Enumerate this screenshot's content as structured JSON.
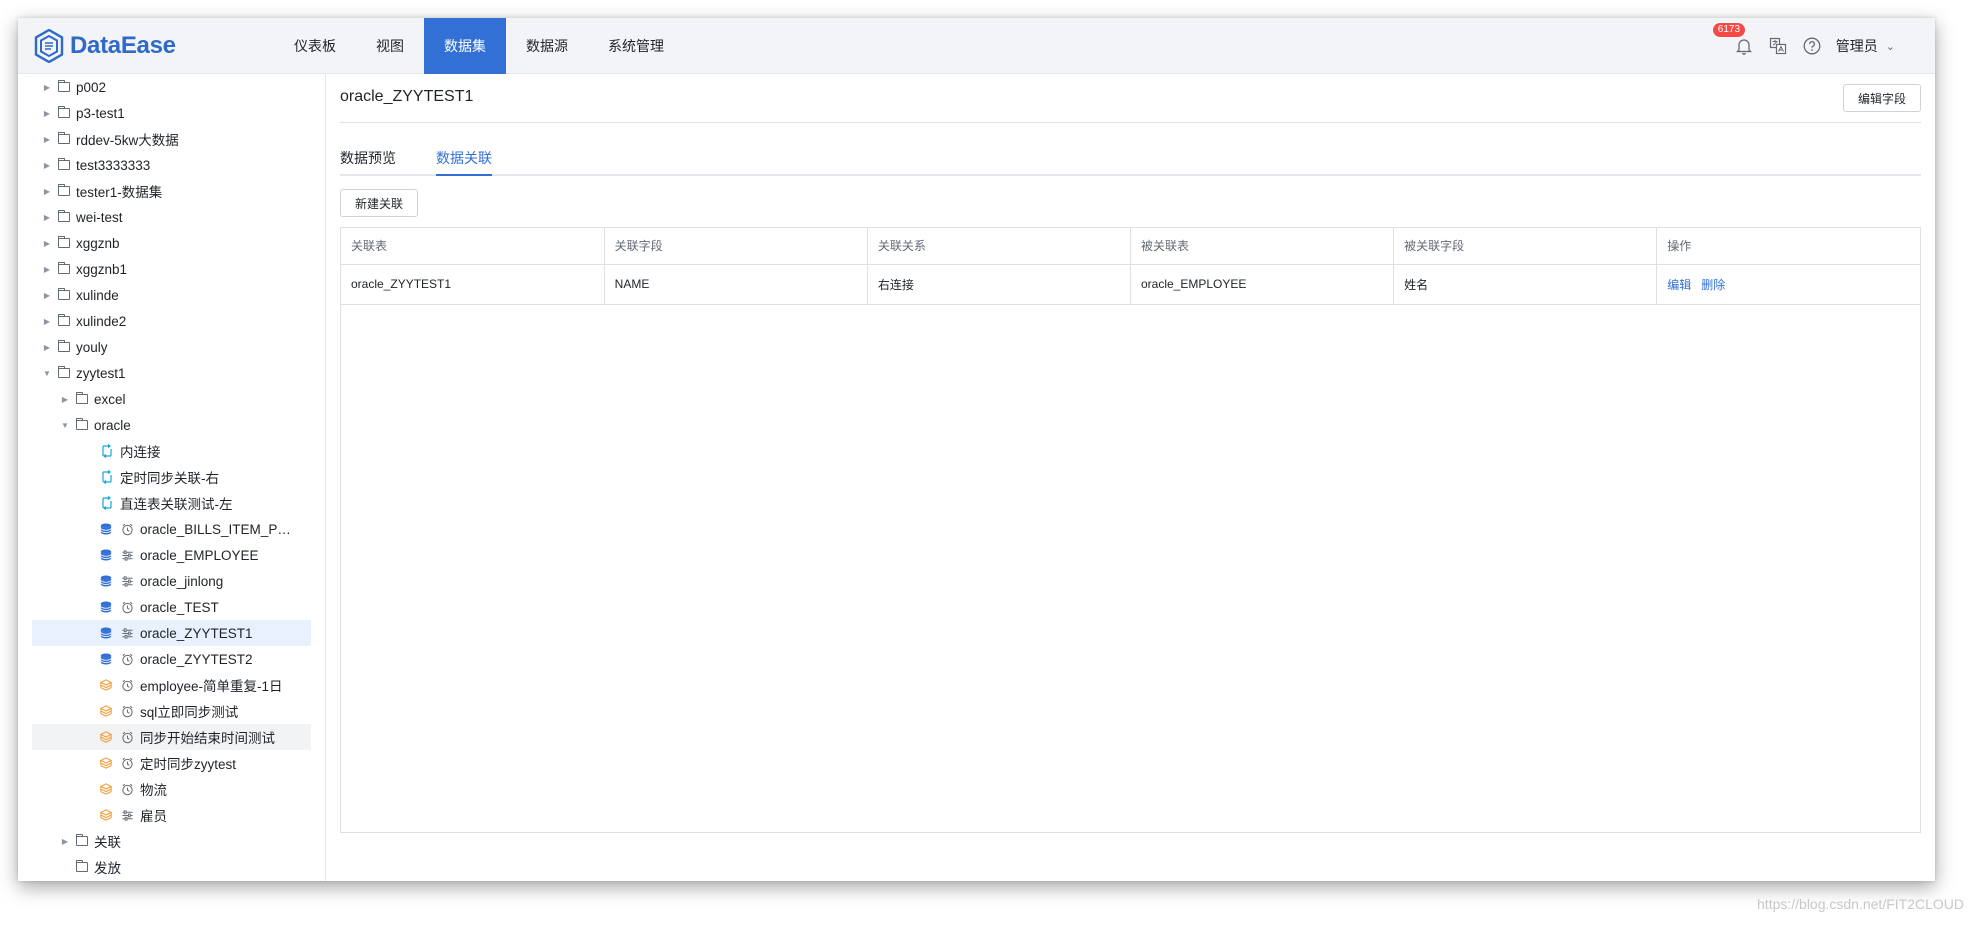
{
  "app": {
    "logo_text": "DataEase"
  },
  "nav": {
    "items": [
      "仪表板",
      "视图",
      "数据集",
      "数据源",
      "系统管理"
    ],
    "active_index": 2
  },
  "header": {
    "notification_count": "6173",
    "user": "管理员"
  },
  "sidebar": {
    "tree": [
      {
        "label": "p002",
        "level": 0,
        "kind": "folder",
        "caret": "right"
      },
      {
        "label": "p3-test1",
        "level": 0,
        "kind": "folder",
        "caret": "right"
      },
      {
        "label": "rddev-5kw大数据",
        "level": 0,
        "kind": "folder",
        "caret": "right"
      },
      {
        "label": "test3333333",
        "level": 0,
        "kind": "folder",
        "caret": "right"
      },
      {
        "label": "tester1-数据集",
        "level": 0,
        "kind": "folder",
        "caret": "right"
      },
      {
        "label": "wei-test",
        "level": 0,
        "kind": "folder",
        "caret": "right"
      },
      {
        "label": "xggznb",
        "level": 0,
        "kind": "folder",
        "caret": "right"
      },
      {
        "label": "xggznb1",
        "level": 0,
        "kind": "folder",
        "caret": "right"
      },
      {
        "label": "xulinde",
        "level": 0,
        "kind": "folder",
        "caret": "right"
      },
      {
        "label": "xulinde2",
        "level": 0,
        "kind": "folder",
        "caret": "right"
      },
      {
        "label": "youly",
        "level": 0,
        "kind": "folder",
        "caret": "right"
      },
      {
        "label": "zyytest1",
        "level": 0,
        "kind": "folder",
        "caret": "down"
      },
      {
        "label": "excel",
        "level": 1,
        "kind": "folder",
        "caret": "right"
      },
      {
        "label": "oracle",
        "level": 1,
        "kind": "folder",
        "caret": "down"
      },
      {
        "label": "内连接",
        "level": 2,
        "kind": "union"
      },
      {
        "label": "定时同步关联-右",
        "level": 2,
        "kind": "union"
      },
      {
        "label": "直连表关联测试-左",
        "level": 2,
        "kind": "union"
      },
      {
        "label": "oracle_BILLS_ITEM_P…",
        "level": 2,
        "kind": "db",
        "mode": "clock"
      },
      {
        "label": "oracle_EMPLOYEE",
        "level": 2,
        "kind": "db",
        "mode": "direct"
      },
      {
        "label": "oracle_jinlong",
        "level": 2,
        "kind": "db",
        "mode": "direct"
      },
      {
        "label": "oracle_TEST",
        "level": 2,
        "kind": "db",
        "mode": "clock"
      },
      {
        "label": "oracle_ZYYTEST1",
        "level": 2,
        "kind": "db",
        "mode": "direct",
        "state": "selected"
      },
      {
        "label": "oracle_ZYYTEST2",
        "level": 2,
        "kind": "db",
        "mode": "clock"
      },
      {
        "label": "employee-简单重复-1日",
        "level": 2,
        "kind": "excel",
        "mode": "clock"
      },
      {
        "label": "sql立即同步测试",
        "level": 2,
        "kind": "excel",
        "mode": "clock"
      },
      {
        "label": "同步开始结束时间测试",
        "level": 2,
        "kind": "excel",
        "mode": "clock",
        "state": "hover"
      },
      {
        "label": "定时同步zyytest",
        "level": 2,
        "kind": "excel",
        "mode": "clock"
      },
      {
        "label": "物流",
        "level": 2,
        "kind": "excel",
        "mode": "clock"
      },
      {
        "label": "雇员",
        "level": 2,
        "kind": "excel",
        "mode": "direct"
      },
      {
        "label": "关联",
        "level": 1,
        "kind": "folder",
        "caret": "right"
      },
      {
        "label": "发放",
        "level": 1,
        "kind": "folder",
        "caret": "none"
      }
    ]
  },
  "main": {
    "title": "oracle_ZYYTEST1",
    "edit_fields_button": "编辑字段",
    "tabs": [
      "数据预览",
      "数据关联"
    ],
    "active_tab": 1,
    "new_relation_button": "新建关联",
    "table": {
      "columns": [
        "关联表",
        "关联字段",
        "关联关系",
        "被关联表",
        "被关联字段",
        "操作"
      ],
      "rows": [
        [
          "oracle_ZYYTEST1",
          "NAME",
          "右连接",
          "oracle_EMPLOYEE",
          "姓名"
        ]
      ],
      "actions": [
        "编辑",
        "删除"
      ]
    }
  },
  "watermark": "https://blog.csdn.net/FIT2CLOUD",
  "colors": {
    "accent": "#3370d6",
    "db_icon": "#3370d6",
    "union_icon": "#16a6d9",
    "excel_icon": "#f2a03f"
  }
}
